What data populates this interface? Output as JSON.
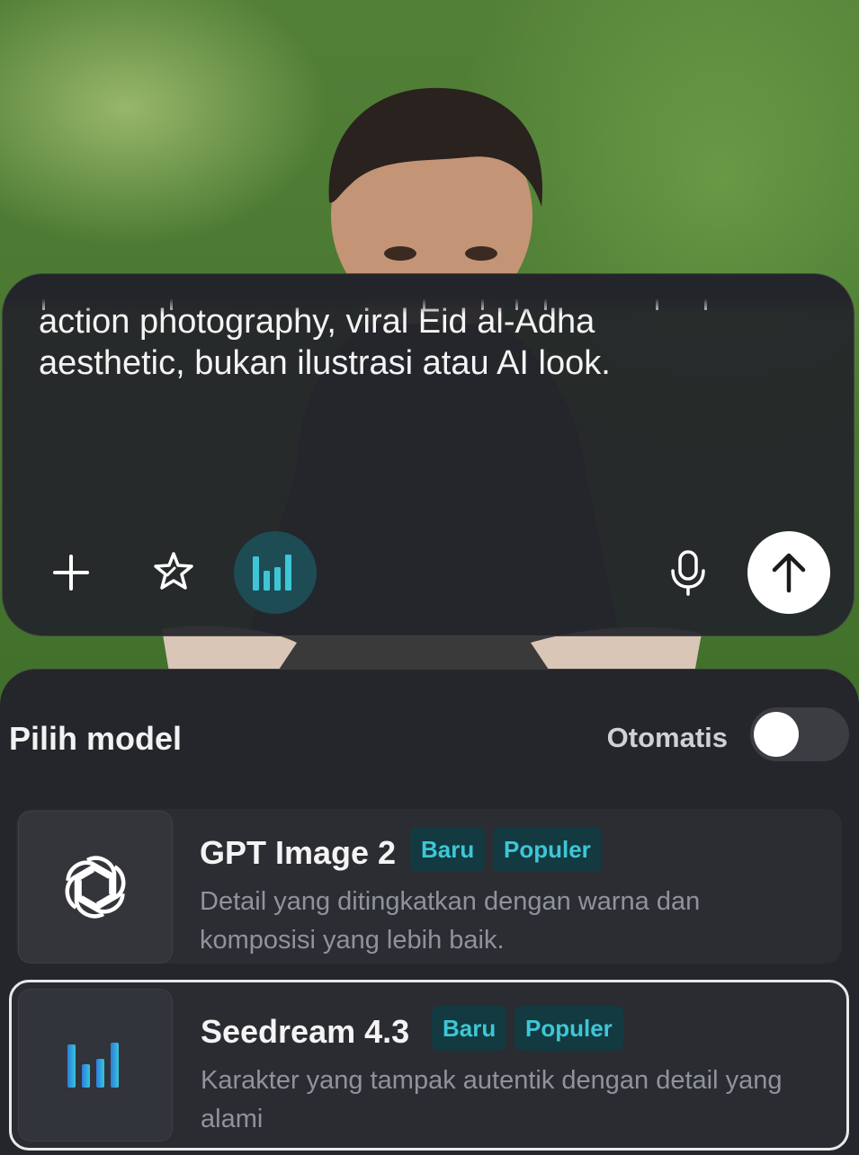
{
  "prompt": {
    "text": "action photography, viral Eid al-Adha\naesthetic, bukan ilustrasi atau AI look.",
    "tools": {
      "add_icon": "plus-icon",
      "enhance_icon": "sparkle-star-icon",
      "model_icon": "seedream-bars-icon",
      "mic_icon": "microphone-icon",
      "send_icon": "arrow-up-icon"
    }
  },
  "model_picker": {
    "title": "Pilih model",
    "auto_label": "Otomatis",
    "auto_enabled": false,
    "models": [
      {
        "name": "GPT Image 2",
        "badges": [
          "Baru",
          "Populer"
        ],
        "description": "Detail yang ditingkatkan dengan warna dan komposisi yang lebih baik.",
        "icon": "openai-logo-icon",
        "selected": false
      },
      {
        "name": "Seedream 4.3",
        "badges": [
          "Baru",
          "Populer"
        ],
        "description": "Karakter yang tampak autentik dengan detail yang alami",
        "icon": "seedream-logo-icon",
        "selected": true
      }
    ]
  },
  "colors": {
    "accent": "#3ec6d6",
    "badge_bg": "#123a40",
    "panel": "#24262b",
    "active_tool": "#1d4c55"
  }
}
